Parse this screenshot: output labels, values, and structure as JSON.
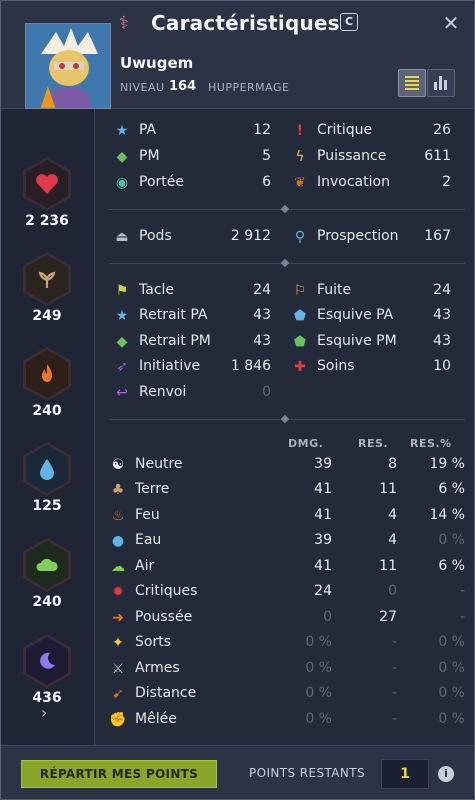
{
  "window": {
    "title": "Caractéristiques",
    "shortcut_key": "C"
  },
  "character": {
    "name": "Uwugem",
    "level_label": "NIVEAU",
    "level": "164",
    "class": "HUPPERMAGE"
  },
  "elements": [
    {
      "name": "vitality",
      "icon": "heart-icon",
      "value": "2 236",
      "color": "#e23a4a"
    },
    {
      "name": "wisdom",
      "icon": "sprout-icon",
      "value": "249",
      "color": "#c9a070"
    },
    {
      "name": "strength-fire",
      "icon": "flame-icon",
      "value": "240",
      "color": "#f07a1a"
    },
    {
      "name": "water",
      "icon": "droplet-icon",
      "value": "125",
      "color": "#5fb4e8"
    },
    {
      "name": "air",
      "icon": "cloud-icon",
      "value": "240",
      "color": "#7fcf5a"
    },
    {
      "name": "chance-moon",
      "icon": "moon-icon",
      "value": "436",
      "color": "#8a7aee"
    }
  ],
  "primary_stats": {
    "left": [
      {
        "label": "PA",
        "value": "12",
        "icon": "star-icon"
      },
      {
        "label": "PM",
        "value": "5",
        "icon": "diamond-icon"
      },
      {
        "label": "Portée",
        "value": "6",
        "icon": "eye-icon"
      }
    ],
    "right": [
      {
        "label": "Critique",
        "value": "26",
        "icon": "exclamation-icon"
      },
      {
        "label": "Puissance",
        "value": "611",
        "icon": "lightning-icon"
      },
      {
        "label": "Invocation",
        "value": "2",
        "icon": "paw-icon"
      }
    ]
  },
  "secondary_stats": {
    "left": [
      {
        "label": "Pods",
        "value": "2 912",
        "icon": "weight-icon"
      }
    ],
    "right": [
      {
        "label": "Prospection",
        "value": "167",
        "icon": "magnifier-icon"
      }
    ]
  },
  "combat_stats": {
    "left": [
      {
        "label": "Tacle",
        "value": "24",
        "icon": "tackle-icon"
      },
      {
        "label": "Retrait PA",
        "value": "43",
        "icon": "ap-reduction-icon"
      },
      {
        "label": "Retrait PM",
        "value": "43",
        "icon": "mp-reduction-icon"
      },
      {
        "label": "Initiative",
        "value": "1 846",
        "icon": "initiative-icon"
      },
      {
        "label": "Renvoi",
        "value": "0",
        "icon": "reflect-icon"
      }
    ],
    "right": [
      {
        "label": "Fuite",
        "value": "24",
        "icon": "dodge-icon"
      },
      {
        "label": "Esquive PA",
        "value": "43",
        "icon": "ap-parry-icon"
      },
      {
        "label": "Esquive PM",
        "value": "43",
        "icon": "mp-parry-icon"
      },
      {
        "label": "Soins",
        "value": "10",
        "icon": "heal-cross-icon"
      }
    ]
  },
  "resist_table": {
    "headers": [
      "DMG.",
      "RES.",
      "RES.%"
    ],
    "rows": [
      {
        "label": "Neutre",
        "icon": "yin-yang-icon",
        "dmg": "39",
        "res": "8",
        "resp": "19 %"
      },
      {
        "label": "Terre",
        "icon": "sprout-icon",
        "dmg": "41",
        "res": "11",
        "resp": "6 %"
      },
      {
        "label": "Feu",
        "icon": "flame-icon",
        "dmg": "41",
        "res": "4",
        "resp": "14 %"
      },
      {
        "label": "Eau",
        "icon": "droplet-icon",
        "dmg": "39",
        "res": "4",
        "resp": "0 %"
      },
      {
        "label": "Air",
        "icon": "cloud-icon",
        "dmg": "41",
        "res": "11",
        "resp": "6 %"
      },
      {
        "label": "Critiques",
        "icon": "crit-damage-icon",
        "dmg": "24",
        "res": "0",
        "resp": "-"
      },
      {
        "label": "Poussée",
        "icon": "arrow-right-icon",
        "dmg": "0",
        "res": "27",
        "resp": "-"
      },
      {
        "label": "Sorts",
        "icon": "sparkle-icon",
        "dmg": "0 %",
        "res": "-",
        "resp": "0 %"
      },
      {
        "label": "Armes",
        "icon": "sword-icon",
        "dmg": "0 %",
        "res": "-",
        "resp": "0 %"
      },
      {
        "label": "Distance",
        "icon": "bow-icon",
        "dmg": "0 %",
        "res": "-",
        "resp": "0 %"
      },
      {
        "label": "Mêlée",
        "icon": "fist-icon",
        "dmg": "0 %",
        "res": "-",
        "resp": "0 %"
      }
    ]
  },
  "footer": {
    "button_label": "RÉPARTIR MES POINTS",
    "points_label": "POINTS RESTANTS",
    "points_value": "1"
  }
}
